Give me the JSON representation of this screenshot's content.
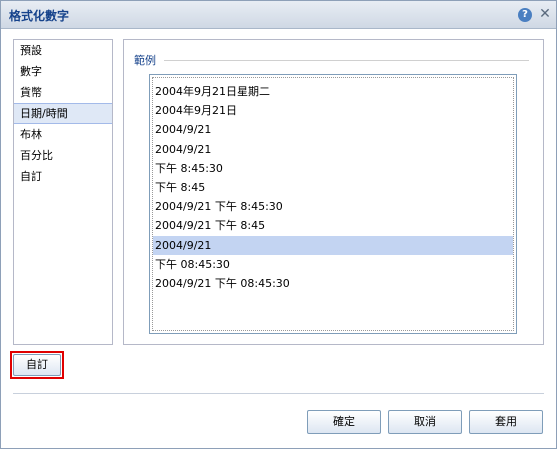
{
  "dialog": {
    "title": "格式化數字",
    "help_glyph": "?",
    "close_glyph": "✕"
  },
  "categories": [
    {
      "label": "預設"
    },
    {
      "label": "數字"
    },
    {
      "label": "貨幣"
    },
    {
      "label": "日期/時間",
      "selected": true
    },
    {
      "label": "布林"
    },
    {
      "label": "百分比"
    },
    {
      "label": "自訂"
    }
  ],
  "sample": {
    "legend": "範例",
    "items": [
      "2004年9月21日星期二",
      "2004年9月21日",
      "2004/9/21",
      "2004/9/21",
      "下午 8:45:30",
      "下午 8:45",
      "2004/9/21 下午 8:45:30",
      "2004/9/21 下午 8:45",
      "2004/9/21",
      "下午 08:45:30",
      "2004/9/21 下午 08:45:30"
    ],
    "selected_index": 8
  },
  "buttons": {
    "custom": "自訂",
    "ok": "確定",
    "cancel": "取消",
    "apply": "套用"
  },
  "colors": {
    "title_text": "#15428b",
    "selection": "#c3d4f2",
    "highlight_box": "#e00000"
  }
}
